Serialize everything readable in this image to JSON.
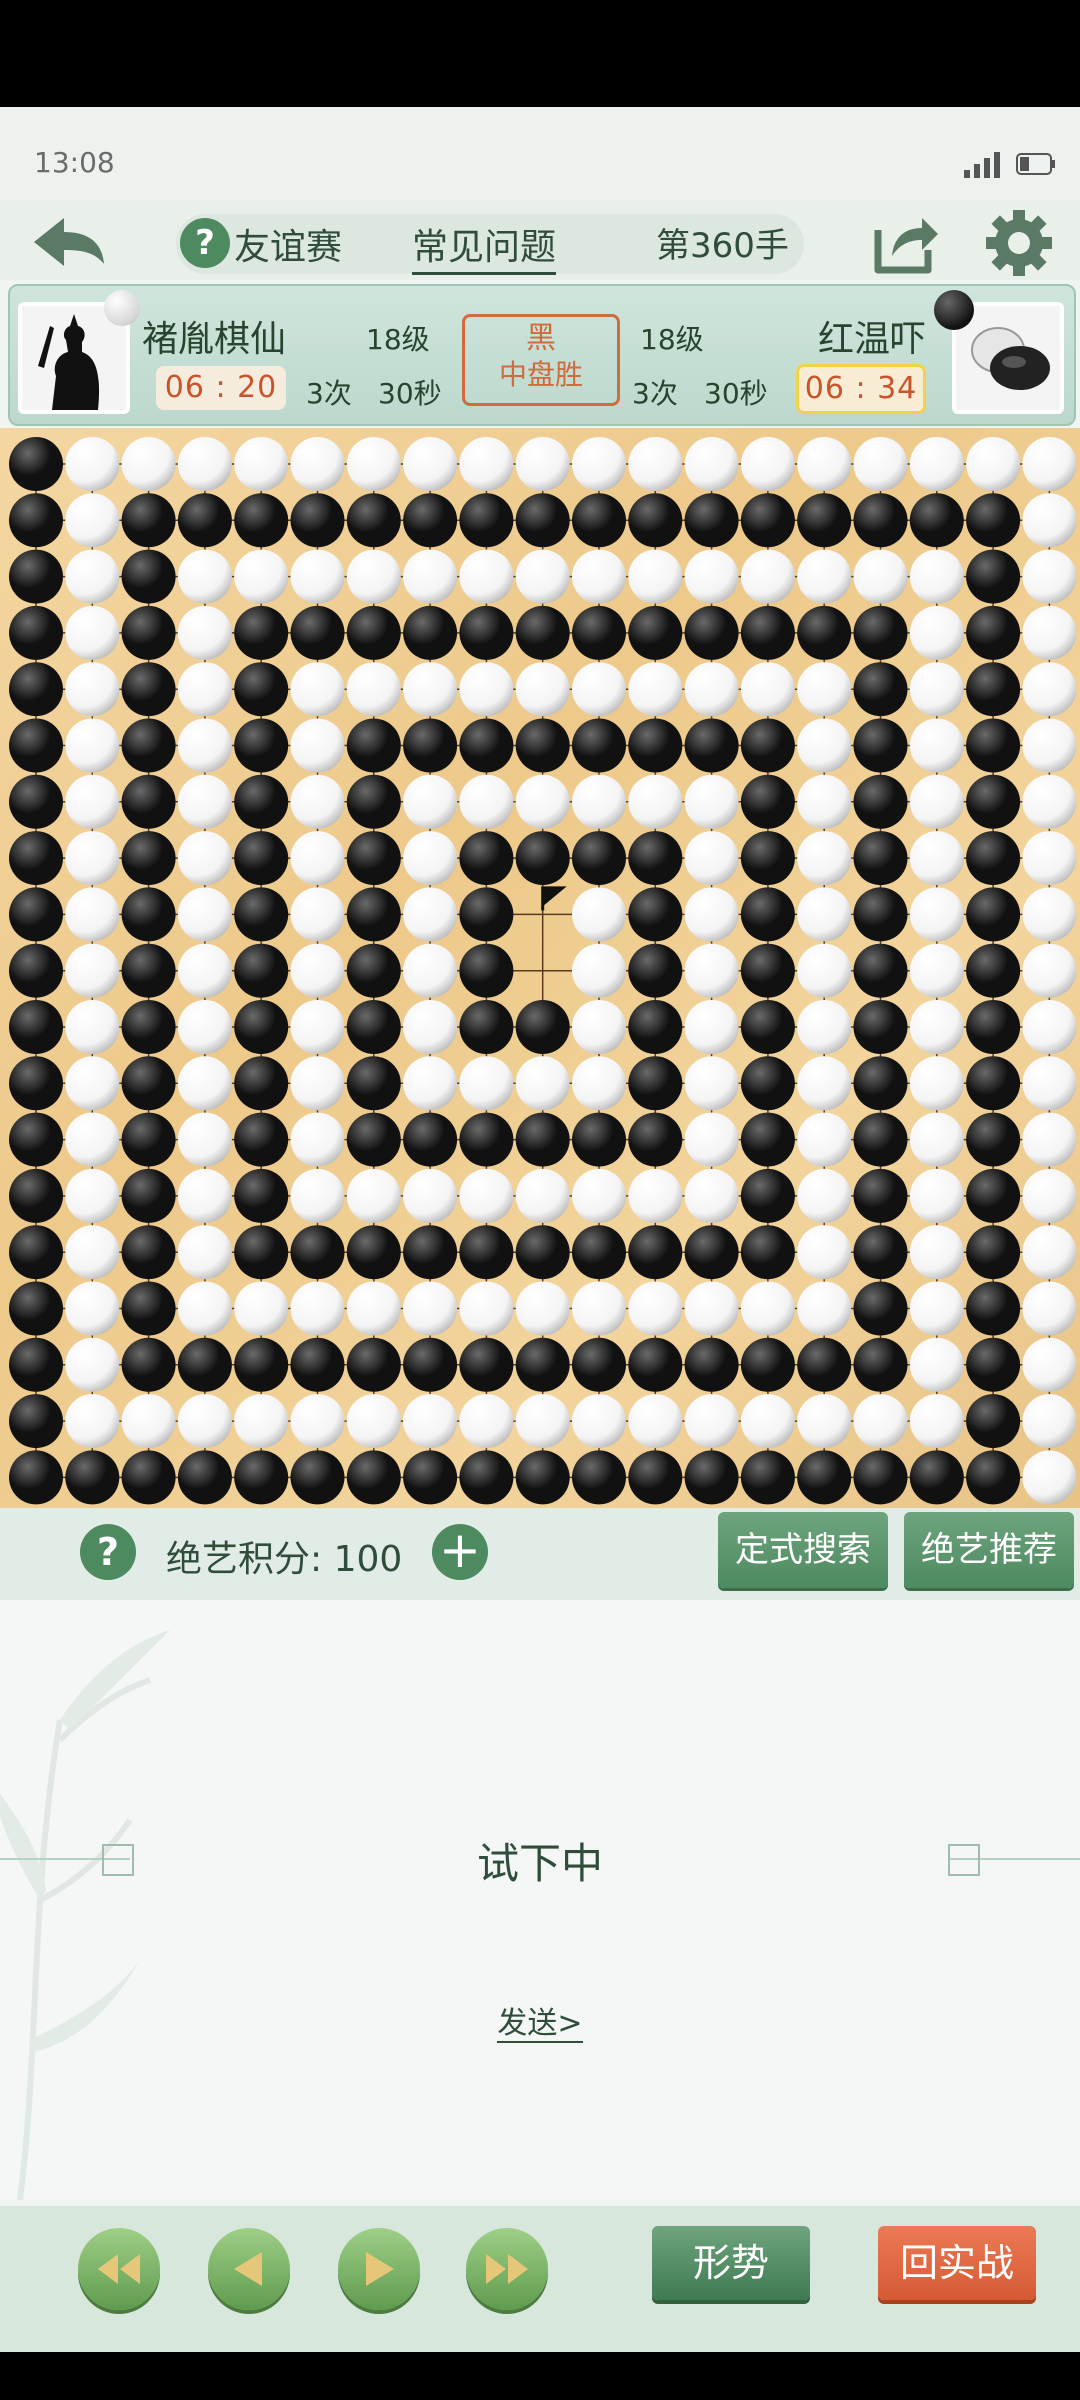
{
  "status_bar": {
    "time": "13:08"
  },
  "header": {
    "match_type": "友谊赛",
    "faq": "常见问题",
    "move_count": "第360手"
  },
  "players": {
    "black": {
      "name": "褚胤棋仙",
      "level": "18级",
      "clock": "06 : 20",
      "byo_count": "3次",
      "byo_time": "30秒"
    },
    "white": {
      "name": "红温吓",
      "level": "18级",
      "clock": "06 : 34",
      "byo_count": "3次",
      "byo_time": "30秒"
    }
  },
  "result": {
    "color": "黑",
    "text": "中盘胜"
  },
  "board": {
    "size": 19,
    "rows": [
      "BWWWWWWWWWWWWWWWWWW",
      "BWBBBBBBBBBBBBBBBBW",
      "BWBWWWWWWWWWWWWWWBW",
      "BWBWBBBBBBBBBBBBWBW",
      "BWBWBWWWWWWWWWWBWBW",
      "BWBWBWBBBBBBBBWBWBW",
      "BWBWBWBWWWWWWBWBWBW",
      "BWBWBWBWBBBBWBWBWBW",
      "BWBWBWBWB.WBWBWBWBW",
      "BWBWBWBWB.WBWBWBWBW",
      "BWBWBWBWBBWBWBWBWBW",
      "BWBWBWBWWWWBWBWBWBW",
      "BWBWBWBBBBBBWBWBWBW",
      "BWBWBWWWWWWWWBWBWBW",
      "BWBWBBBBBBBBBBWBWBW",
      "BWBWWWWWWWWWWWWBWBW",
      "BWBBBBBBBBBBBBBBWBW",
      "BWWWWWWWWWWWWWWWWBW",
      "BBBBBBBBBBBBBBBBBBW"
    ],
    "last_move_marker": "flag",
    "colors": {
      "black": "#111111",
      "white": "#f4f4f4",
      "wood": "#efcf95",
      "line": "#5a3a1e"
    }
  },
  "controls": {
    "score_label": "绝艺积分: 100",
    "joseki_search": "定式搜索",
    "ai_recommend": "绝艺推荐"
  },
  "panel": {
    "status": "试下中",
    "send": "发送>"
  },
  "footer": {
    "trend": "形势",
    "back_to_real": "回实战"
  },
  "icons": {
    "back": "back-arrow-icon",
    "help": "question-icon",
    "share": "share-icon",
    "settings": "gear-icon",
    "plus": "plus-icon",
    "first": "fast-backward-icon",
    "prev": "step-backward-icon",
    "next": "step-forward-icon",
    "last": "fast-forward-icon"
  }
}
